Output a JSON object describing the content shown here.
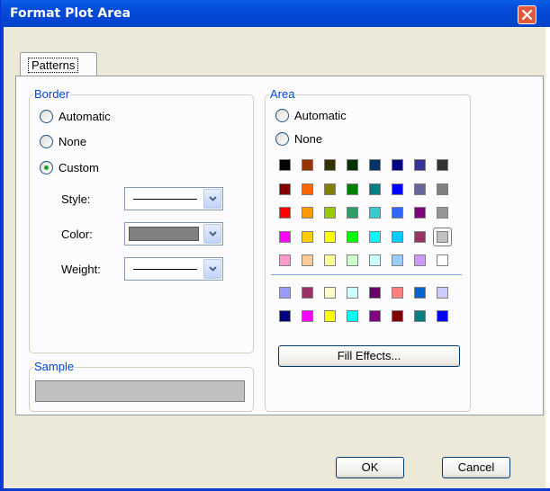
{
  "window": {
    "title": "Format Plot Area",
    "close_label": "close"
  },
  "tabs": [
    {
      "label": "Patterns"
    }
  ],
  "border_group": {
    "label": "Border",
    "options": [
      {
        "label": "Automatic",
        "checked": false
      },
      {
        "label": "None",
        "checked": false
      },
      {
        "label": "Custom",
        "checked": true
      }
    ],
    "style_label": "Style:",
    "color_label": "Color:",
    "weight_label": "Weight:",
    "color_value": "#808080"
  },
  "sample_group": {
    "label": "Sample",
    "sample_color": "#c0c0c0"
  },
  "area_group": {
    "label": "Area",
    "options": [
      {
        "label": "Automatic",
        "checked": false
      },
      {
        "label": "None",
        "checked": false
      }
    ],
    "palette_main": [
      [
        "#000000",
        "#993300",
        "#333300",
        "#003300",
        "#003366",
        "#000080",
        "#333399",
        "#333333"
      ],
      [
        "#800000",
        "#ff6600",
        "#808000",
        "#008000",
        "#008080",
        "#0000ff",
        "#666699",
        "#808080"
      ],
      [
        "#ff0000",
        "#ff9900",
        "#99cc00",
        "#339966",
        "#33cccc",
        "#3366ff",
        "#800080",
        "#969696"
      ],
      [
        "#ff00ff",
        "#ffcc00",
        "#ffff00",
        "#00ff00",
        "#00ffff",
        "#00ccff",
        "#993366",
        "#c0c0c0"
      ],
      [
        "#ff99cc",
        "#ffcc99",
        "#ffff99",
        "#ccffcc",
        "#ccffff",
        "#99ccff",
        "#cc99ff",
        "#ffffff"
      ]
    ],
    "palette_chart": [
      [
        "#9999ff",
        "#993366",
        "#ffffcc",
        "#ccffff",
        "#660066",
        "#ff8080",
        "#0066cc",
        "#ccccff"
      ],
      [
        "#000080",
        "#ff00ff",
        "#ffff00",
        "#00ffff",
        "#800080",
        "#800000",
        "#008080",
        "#0000ff"
      ]
    ],
    "selected_color": "#c0c0c0",
    "fill_effects_label": "Fill Effects..."
  },
  "buttons": {
    "ok": "OK",
    "cancel": "Cancel"
  }
}
